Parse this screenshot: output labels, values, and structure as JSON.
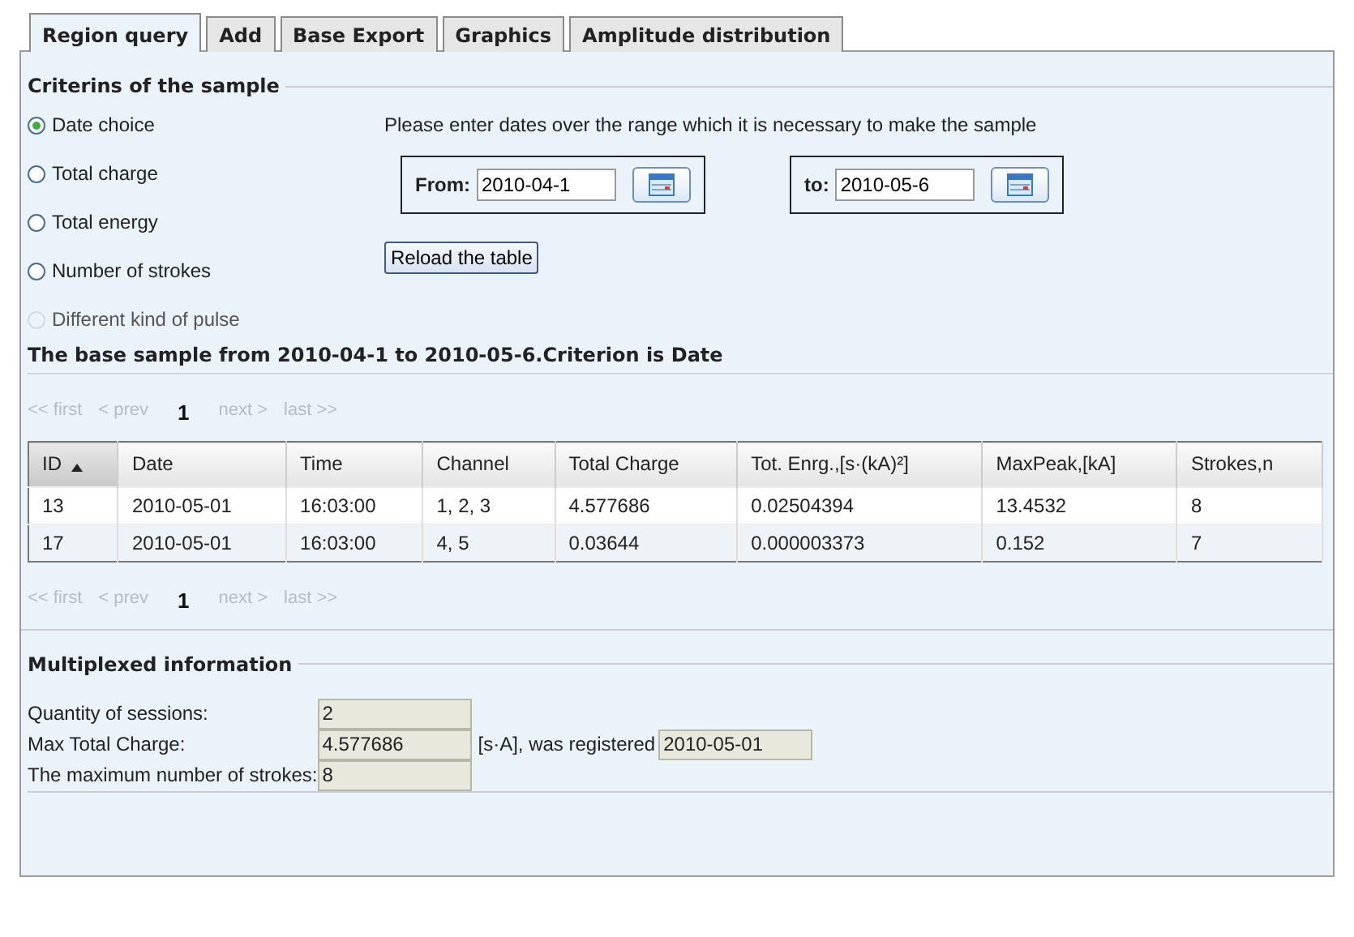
{
  "tabs": [
    {
      "label": "Region query",
      "selected": true
    },
    {
      "label": "Add",
      "selected": false
    },
    {
      "label": "Base Export",
      "selected": false
    },
    {
      "label": "Graphics",
      "selected": false
    },
    {
      "label": "Amplitude distribution",
      "selected": false
    }
  ],
  "criteria": {
    "legend": "Criterins of the sample",
    "options": [
      {
        "label": "Date choice",
        "selected": true,
        "disabled": false
      },
      {
        "label": "Total charge",
        "selected": false,
        "disabled": false
      },
      {
        "label": "Total energy",
        "selected": false,
        "disabled": false
      },
      {
        "label": "Number of strokes",
        "selected": false,
        "disabled": false
      },
      {
        "label": "Different kind of pulse",
        "selected": false,
        "disabled": true
      }
    ],
    "prompt": "Please enter dates over the range which it is necessary to make the sample",
    "from": {
      "label": "From:",
      "value": "2010-04-1"
    },
    "to": {
      "label": "to:",
      "value": "2010-05-6"
    },
    "reload_button": "Reload the table"
  },
  "results": {
    "title": "The base sample from 2010-04-1 to 2010-05-6.Criterion is Date",
    "pager_top": [
      {
        "label": "<< first",
        "disabled": true,
        "selected": false
      },
      {
        "label": "< prev",
        "disabled": true,
        "selected": false
      },
      {
        "label": "1",
        "disabled": false,
        "selected": true
      },
      {
        "label": "next >",
        "disabled": true,
        "selected": false
      },
      {
        "label": "last >>",
        "disabled": true,
        "selected": false
      }
    ],
    "columns": [
      {
        "label": "ID",
        "sorted": true
      },
      {
        "label": "Date",
        "sorted": false
      },
      {
        "label": "Time",
        "sorted": false
      },
      {
        "label": "Channel",
        "sorted": false
      },
      {
        "label": "Total Charge",
        "sorted": false
      },
      {
        "label": "Tot. Enrg.,[s·(kA)²]",
        "sorted": false
      },
      {
        "label": "MaxPeak,[kA]",
        "sorted": false
      },
      {
        "label": "Strokes,n",
        "sorted": false
      }
    ],
    "rows": [
      [
        "13",
        "2010-05-01",
        "16:03:00",
        "1, 2, 3",
        "4.577686",
        "0.02504394",
        "13.4532",
        "8"
      ],
      [
        "17",
        "2010-05-01",
        "16:03:00",
        "4, 5",
        "0.03644",
        "0.000003373",
        "0.152",
        "7"
      ]
    ],
    "pager_bottom": [
      {
        "label": "<< first",
        "disabled": true,
        "selected": false
      },
      {
        "label": "< prev",
        "disabled": true,
        "selected": false
      },
      {
        "label": "1",
        "disabled": false,
        "selected": true
      },
      {
        "label": "next >",
        "disabled": true,
        "selected": false
      },
      {
        "label": "last >>",
        "disabled": true,
        "selected": false
      }
    ]
  },
  "summary": {
    "legend": "Multiplexed information",
    "sessions": {
      "label": "Quantity of sessions:",
      "value": "2"
    },
    "max_charge": {
      "label": "Max Total Charge:",
      "value": "4.577686",
      "unit": "[s·A], was registered",
      "date": "2010-05-01"
    },
    "max_strokes": {
      "label": "The maximum number of strokes:",
      "value": "8"
    }
  }
}
